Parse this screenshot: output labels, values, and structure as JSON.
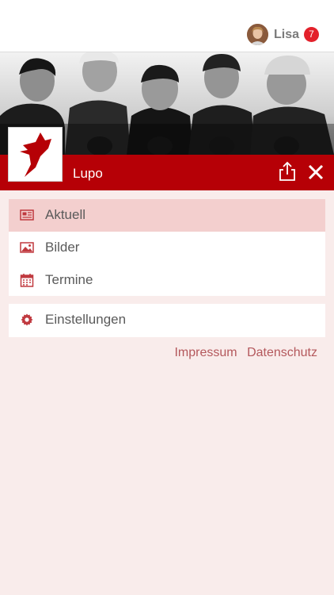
{
  "header": {
    "user_name": "Lisa",
    "notification_count": "7"
  },
  "brand": {
    "name": "Lupo",
    "accent_color": "#b60006"
  },
  "menu": {
    "items": [
      {
        "label": "Aktuell",
        "icon": "newspaper-icon",
        "active": true
      },
      {
        "label": "Bilder",
        "icon": "image-icon",
        "active": false
      },
      {
        "label": "Termine",
        "icon": "calendar-icon",
        "active": false
      }
    ],
    "settings_label": "Einstellungen",
    "settings_icon": "gear-icon"
  },
  "footer": {
    "impressum": "Impressum",
    "datenschutz": "Datenschutz"
  }
}
